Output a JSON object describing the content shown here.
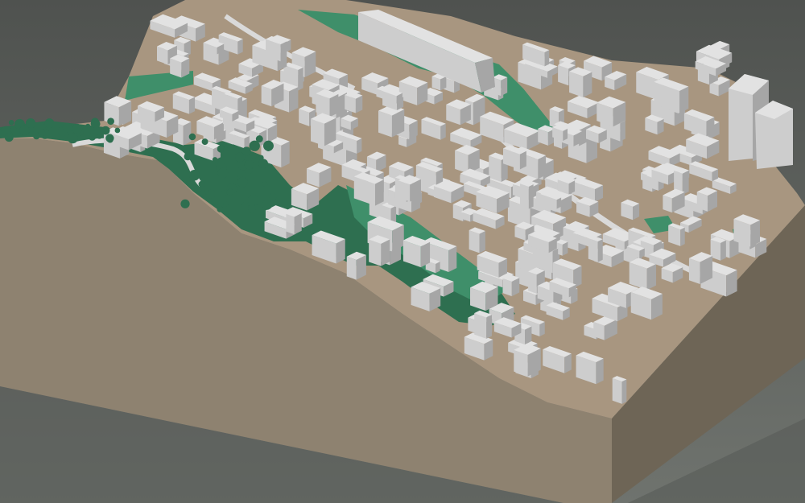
{
  "scene": {
    "subject": "3d-terrain-city-model",
    "colors": {
      "background_top": "#4f524f",
      "background_bottom": "#6f736e",
      "terrain_side": "#8e8270",
      "terrain_side_dark": "#6e6556",
      "terrain_top": "#a89680",
      "vegetation": "#3f8f6a",
      "vegetation_dark": "#2e6f50",
      "building": "#cdcdcd",
      "building_light": "#e2e2e2",
      "building_shadow": "#a6a6a6",
      "road": "#d9d9d9"
    }
  }
}
